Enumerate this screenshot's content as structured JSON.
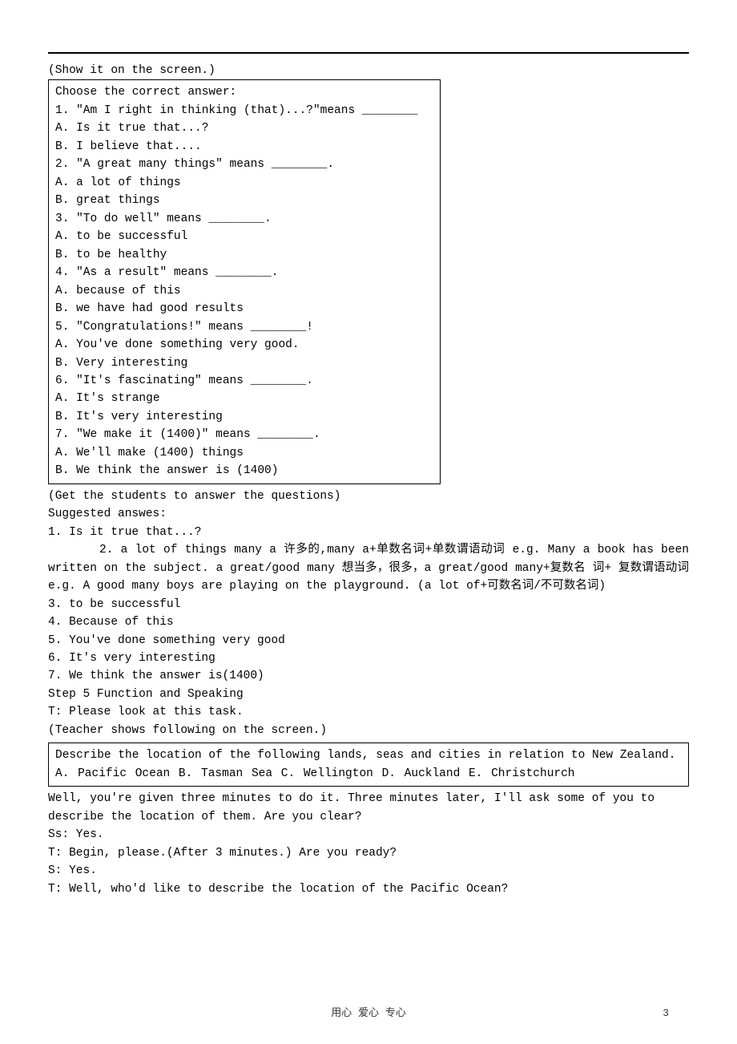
{
  "intro": "(Show it on the screen.)",
  "quiz": {
    "heading": "Choose the correct answer:",
    "items": [
      {
        "q": "1. \"Am I right in thinking (that)...?\"means ________",
        "a": "A. Is it true that...?",
        "b": "B. I believe that...."
      },
      {
        "q": "2. \"A great many things\" means ________.",
        "a": "A. a lot of things",
        "b": "B. great things"
      },
      {
        "q": "3. \"To do well\" means ________.",
        "a": "A. to be successful",
        "b": "B. to be healthy"
      },
      {
        "q": "4. \"As a result\" means ________.",
        "a": "A. because of this",
        "b": "B. we have had good results"
      },
      {
        "q": "5. \"Congratulations!\" means ________!",
        "a": "A. You've done something very good.",
        "b": "B. Very interesting"
      },
      {
        "q": "6. \"It's fascinating\" means ________.",
        "a": "A. It's strange",
        "b": "B. It's very interesting"
      },
      {
        "q": "7. \"We make it (1400)\" means ________.",
        "a": "A. We'll make (1400) things",
        "b": "B. We think the answer is (1400)"
      }
    ]
  },
  "after_quiz": [
    "(Get the students to answer the questions)",
    "Suggested answes:",
    "1. Is it true that...?"
  ],
  "answer2": "2. a lot of things many a 许多的,many a+单数名词+单数谓语动词 e.g. Many a book has been written on the subject. a great/good many 想当多，很多，a great/good many+复数名  词+  复数谓语动词 e.g. A good many boys are playing on the playground. (a lot of+可数名词/不可数名词)",
  "answers_rest": [
    "3. to be successful",
    "4. Because of this",
    "5. You've done something very good",
    "6. It's very interesting",
    "7. We think the answer is(1400)",
    "Step 5 Function and Speaking",
    "T: Please look at this task.",
    "(Teacher shows following on the screen.)"
  ],
  "box2": {
    "line1": "Describe the location of the following lands, seas and cities in relation to New Zealand.",
    "line2": "A. Pacific Ocean  B. Tasman Sea  C. Wellington    D. Auckland     E. Christchurch"
  },
  "tail": [
    {
      "cls": "indent1",
      "t": "Well, you're given three minutes to do it. Three minutes later, I'll ask some of you to"
    },
    {
      "cls": "indent0",
      "t": "describe the location of them. Are you clear?"
    },
    {
      "cls": "indent1",
      "t": "Ss: Yes."
    },
    {
      "cls": "indent1",
      "t": "T: Begin, please.(After 3 minutes.) Are you ready?"
    },
    {
      "cls": "indent1",
      "t": "S: Yes."
    },
    {
      "cls": "indent1",
      "t": "T: Well, who'd like to describe the location of the Pacific Ocean?"
    }
  ],
  "footer": "用心 爱心 专心",
  "page_number": "3"
}
